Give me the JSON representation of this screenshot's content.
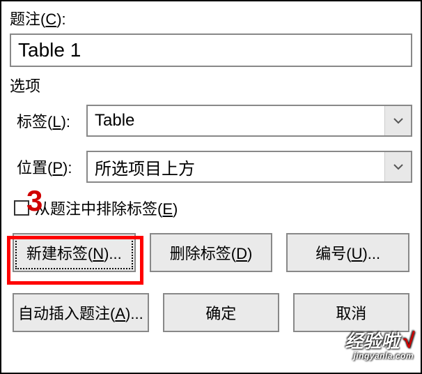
{
  "caption": {
    "label_pre": "题注(",
    "label_key": "C",
    "label_post": "):",
    "value": "Table 1"
  },
  "options": {
    "title": "选项",
    "label": {
      "pre": "标签(",
      "key": "L",
      "post": "):",
      "value": "Table"
    },
    "position": {
      "pre": "位置(",
      "key": "P",
      "post": "):",
      "value": "所选项目上方"
    }
  },
  "exclude": {
    "pre": "从题注中排除标签(",
    "key": "E",
    "post": ")",
    "checked": false
  },
  "step_marker": "3",
  "buttons": {
    "new_label": {
      "pre": "新建标签(",
      "key": "N",
      "post": ")..."
    },
    "delete_label": {
      "pre": "删除标签(",
      "key": "D",
      "post": ")"
    },
    "numbering": {
      "pre": "编号(",
      "key": "U",
      "post": ")..."
    },
    "auto_caption": {
      "pre": "自动插入题注(",
      "key": "A",
      "post": ")..."
    },
    "ok": "确定",
    "cancel": "取消"
  },
  "watermark": {
    "main": "经验啦",
    "sub": "jingyanla.com",
    "check": "√"
  }
}
